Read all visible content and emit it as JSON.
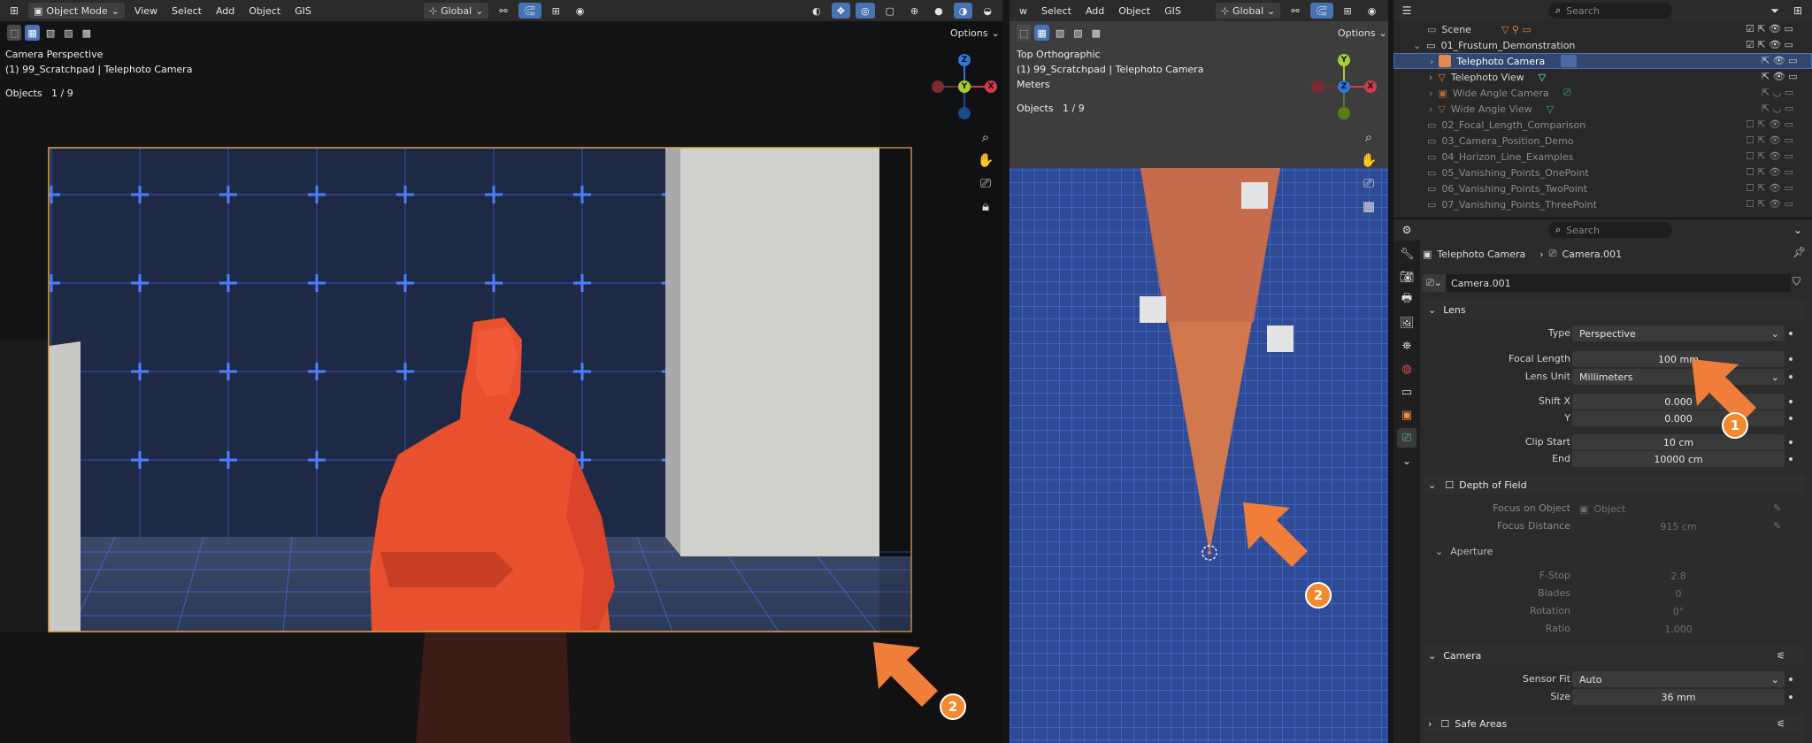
{
  "left_viewport": {
    "header": {
      "mode_label": "Object Mode",
      "menus": [
        "View",
        "Select",
        "Add",
        "Object",
        "GIS"
      ],
      "transform_orientation": "Global",
      "options_label": "Options"
    },
    "overlay": {
      "view_name": "Camera Perspective",
      "collection_info": "(1) 99_Scratchpad | Telephoto Camera",
      "objects_label": "Objects",
      "objects_count": "1 / 9"
    },
    "gizmo": {
      "z": "Z",
      "y": "Y",
      "x": "X"
    },
    "callout_2": "2"
  },
  "right_viewport": {
    "header": {
      "menus": [
        "w",
        "Select",
        "Add",
        "Object",
        "GIS"
      ],
      "transform_orientation": "Global",
      "options_label": "Options"
    },
    "overlay": {
      "view_name": "Top Orthographic",
      "collection_info": "(1) 99_Scratchpad | Telephoto Camera",
      "units": "Meters",
      "objects_label": "Objects",
      "objects_count": "1 / 9"
    },
    "gizmo": {
      "z": "Z",
      "y": "Y",
      "x": "X"
    },
    "callout_2": "2"
  },
  "outliner": {
    "search_placeholder": "Search",
    "rows": [
      {
        "label": "Scene"
      },
      {
        "label": "01_Frustum_Demonstration"
      },
      {
        "label": "Telephoto Camera",
        "selected": true
      },
      {
        "label": "Telephoto View"
      },
      {
        "label": "Wide Angle Camera"
      },
      {
        "label": "Wide Angle View"
      },
      {
        "label": "02_Focal_Length_Comparison"
      },
      {
        "label": "03_Camera_Position_Demo"
      },
      {
        "label": "04_Horizon_Line_Examples"
      },
      {
        "label": "05_Vanishing_Points_OnePoint"
      },
      {
        "label": "06_Vanishing_Points_TwoPoint"
      },
      {
        "label": "07_Vanishing_Points_ThreePoint"
      }
    ]
  },
  "properties": {
    "search_placeholder": "Search",
    "breadcrumb_object": "Telephoto Camera",
    "breadcrumb_data": "Camera.001",
    "datablock_name": "Camera.001",
    "lens": {
      "title": "Lens",
      "type_label": "Type",
      "type_value": "Perspective",
      "focal_length_label": "Focal Length",
      "focal_length_value": "100 mm",
      "lens_unit_label": "Lens Unit",
      "lens_unit_value": "Millimeters",
      "shift_x_label": "Shift X",
      "shift_x_value": "0.000",
      "shift_y_label": "Y",
      "shift_y_value": "0.000",
      "clip_start_label": "Clip Start",
      "clip_start_value": "10 cm",
      "clip_end_label": "End",
      "clip_end_value": "10000 cm"
    },
    "dof": {
      "title": "Depth of Field",
      "focus_object_label": "Focus on Object",
      "focus_object_placeholder": "Object",
      "focus_distance_label": "Focus Distance",
      "focus_distance_value": "915 cm",
      "aperture_title": "Aperture",
      "fstop_label": "F-Stop",
      "fstop_value": "2.8",
      "blades_label": "Blades",
      "blades_value": "0",
      "rotation_label": "Rotation",
      "rotation_value": "0°",
      "ratio_label": "Ratio",
      "ratio_value": "1.000"
    },
    "camera": {
      "title": "Camera",
      "sensor_fit_label": "Sensor Fit",
      "sensor_fit_value": "Auto",
      "size_label": "Size",
      "size_value": "36 mm"
    },
    "safe_areas_title": "Safe Areas",
    "callout_1": "1"
  }
}
